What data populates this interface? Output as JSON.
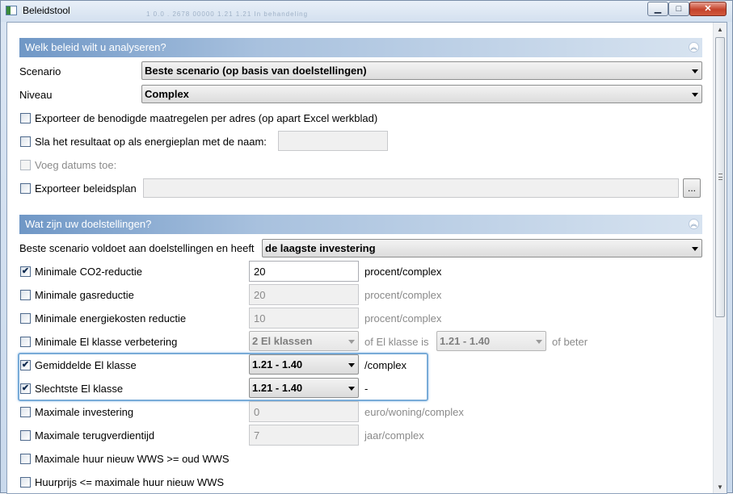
{
  "window": {
    "title": "Beleidstool",
    "ghost_text": "1        0.0 .      2678      00000     1.21    1.21        In behandeling",
    "buttons": {
      "minimize": "▁",
      "maximize": "□",
      "close": "✕"
    }
  },
  "section1": {
    "header": "Welk beleid wilt u analyseren?",
    "scenario_label": "Scenario",
    "scenario_value": "Beste scenario (op basis van doelstellingen)",
    "niveau_label": "Niveau",
    "niveau_value": "Complex",
    "export_measures_label": "Exporteer de benodigde maatregelen per adres (op apart Excel werkblad)",
    "save_plan_label": "Sla het resultaat op als energieplan met de naam:",
    "save_plan_value": "",
    "add_dates_label": "Voeg datums toe:",
    "export_policy_label": "Exporteer beleidsplan",
    "export_policy_value": "",
    "browse_label": "..."
  },
  "section2": {
    "header": "Wat zijn uw doelstellingen?",
    "goal_label": "Beste scenario voldoet aan doelstellingen en heeft",
    "goal_value": "de laagste investering",
    "rows": [
      {
        "label": "Minimale CO2-reductie",
        "checked": true,
        "value": "20",
        "unit": "procent/complex"
      },
      {
        "label": "Minimale gasreductie",
        "checked": false,
        "value": "20",
        "unit": "procent/complex"
      },
      {
        "label": "Minimale energiekosten reductie",
        "checked": false,
        "value": "10",
        "unit": "procent/complex"
      },
      {
        "label": "Minimale El klasse verbetering",
        "checked": false,
        "value": "2 El klassen",
        "unit": "of El klasse is",
        "value2": "1.21 - 1.40",
        "unit2": "of beter"
      },
      {
        "label": "Gemiddelde El klasse",
        "checked": true,
        "value": "1.21 - 1.40",
        "unit": "/complex"
      },
      {
        "label": "Slechtste El klasse",
        "checked": true,
        "value": "1.21 - 1.40",
        "unit": "-"
      },
      {
        "label": "Maximale investering",
        "checked": false,
        "value": "0",
        "unit": "euro/woning/complex"
      },
      {
        "label": "Maximale terugverdientijd",
        "checked": false,
        "value": "7",
        "unit": "jaar/complex"
      },
      {
        "label": "Maximale huur nieuw WWS >= oud WWS",
        "checked": false
      },
      {
        "label": "Huurprijs <= maximale huur nieuw WWS",
        "checked": false
      }
    ]
  },
  "icons": {
    "check": "✔",
    "collapse": "︽",
    "scroll_up": "▲",
    "scroll_down": "▼"
  }
}
